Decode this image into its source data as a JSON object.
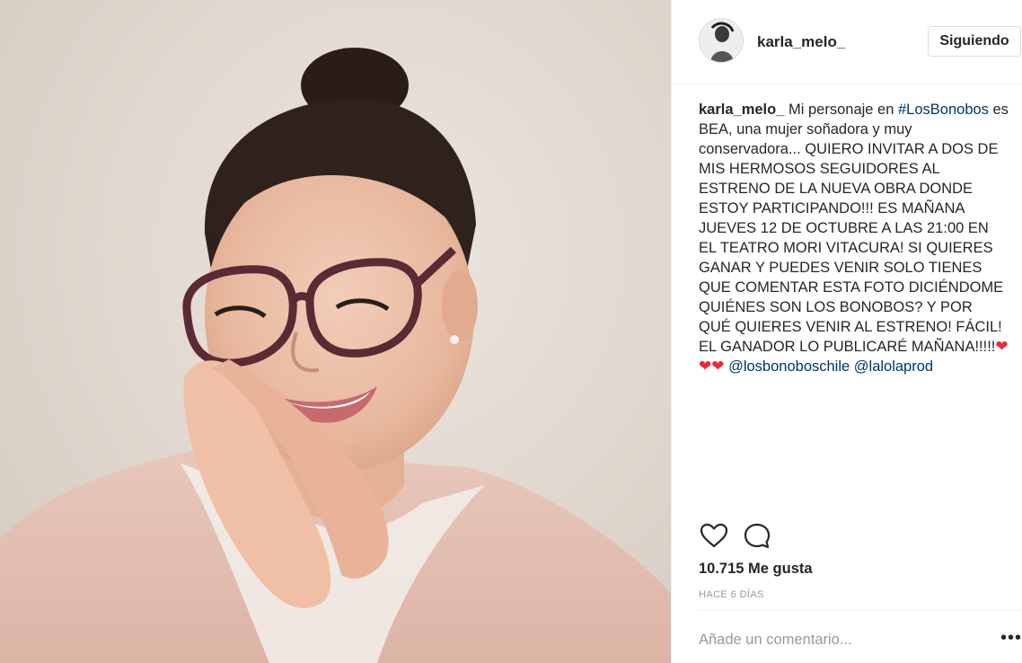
{
  "post": {
    "photo_description_icon": "portrait-photo",
    "author": {
      "username": "karla_melo_",
      "follow_label": "Siguiendo"
    },
    "caption": {
      "username": "karla_melo_",
      "text_1": "Mi personaje en ",
      "hashtag": "#LosBonobos",
      "text_2": " es BEA, una mujer soñadora y muy conservadora... QUIERO INVITAR A DOS DE MIS HERMOSOS SEGUIDORES AL ESTRENO DE LA NUEVA OBRA DONDE ESTOY PARTICIPANDO!!! ES MAÑANA JUEVES 12 DE OCTUBRE A LAS 21:00 EN EL TEATRO MORI VITACURA! SI QUIERES GANAR Y PUEDES VENIR SOLO TIENES QUE COMENTAR ESTA FOTO DICIÉNDOME QUIÉNES SON LOS BONOBOS? Y POR QUÉ QUIERES VENIR AL ESTRENO! FÁCIL! EL GANADOR LO PUBLICARÉ MAÑANA!!!!!",
      "hearts_1": "❤",
      "hearts_2": "❤❤",
      "mention_1": "@losbonoboschile",
      "mention_2": "@lalolaprod"
    },
    "actions": {
      "like_icon": "heart-outline-icon",
      "comment_icon": "speech-bubble-icon"
    },
    "likes": "10.715 Me gusta",
    "timestamp": "HACE 6 DÍAS",
    "comment": {
      "placeholder": "Añade un comentario...",
      "more_label": "•••"
    },
    "colors": {
      "link": "#003569",
      "text": "#262626",
      "muted": "#999999",
      "border": "#dbdbdb",
      "heart": "#ed2939"
    }
  }
}
